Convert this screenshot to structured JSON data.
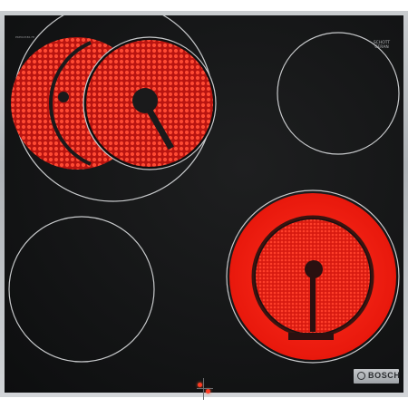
{
  "brand": {
    "name": "BOSCH",
    "glass_maker_lines": [
      "SCHOTT",
      "CERAN"
    ],
    "model_text": "PKE645B17E"
  },
  "zones": [
    {
      "id": "rear-left-dual",
      "state": "on",
      "type": "dual-circle"
    },
    {
      "id": "rear-right",
      "state": "off",
      "type": "single"
    },
    {
      "id": "front-left",
      "state": "off",
      "type": "single"
    },
    {
      "id": "front-right-dual",
      "state": "on",
      "type": "dual-ring"
    }
  ],
  "indicators": {
    "count": 2,
    "color": "#ff3a22"
  },
  "colors": {
    "glass": "#121314",
    "frame": "#b9bcc0",
    "heat": "#ff2a1a",
    "outline": "#c8cacc"
  }
}
